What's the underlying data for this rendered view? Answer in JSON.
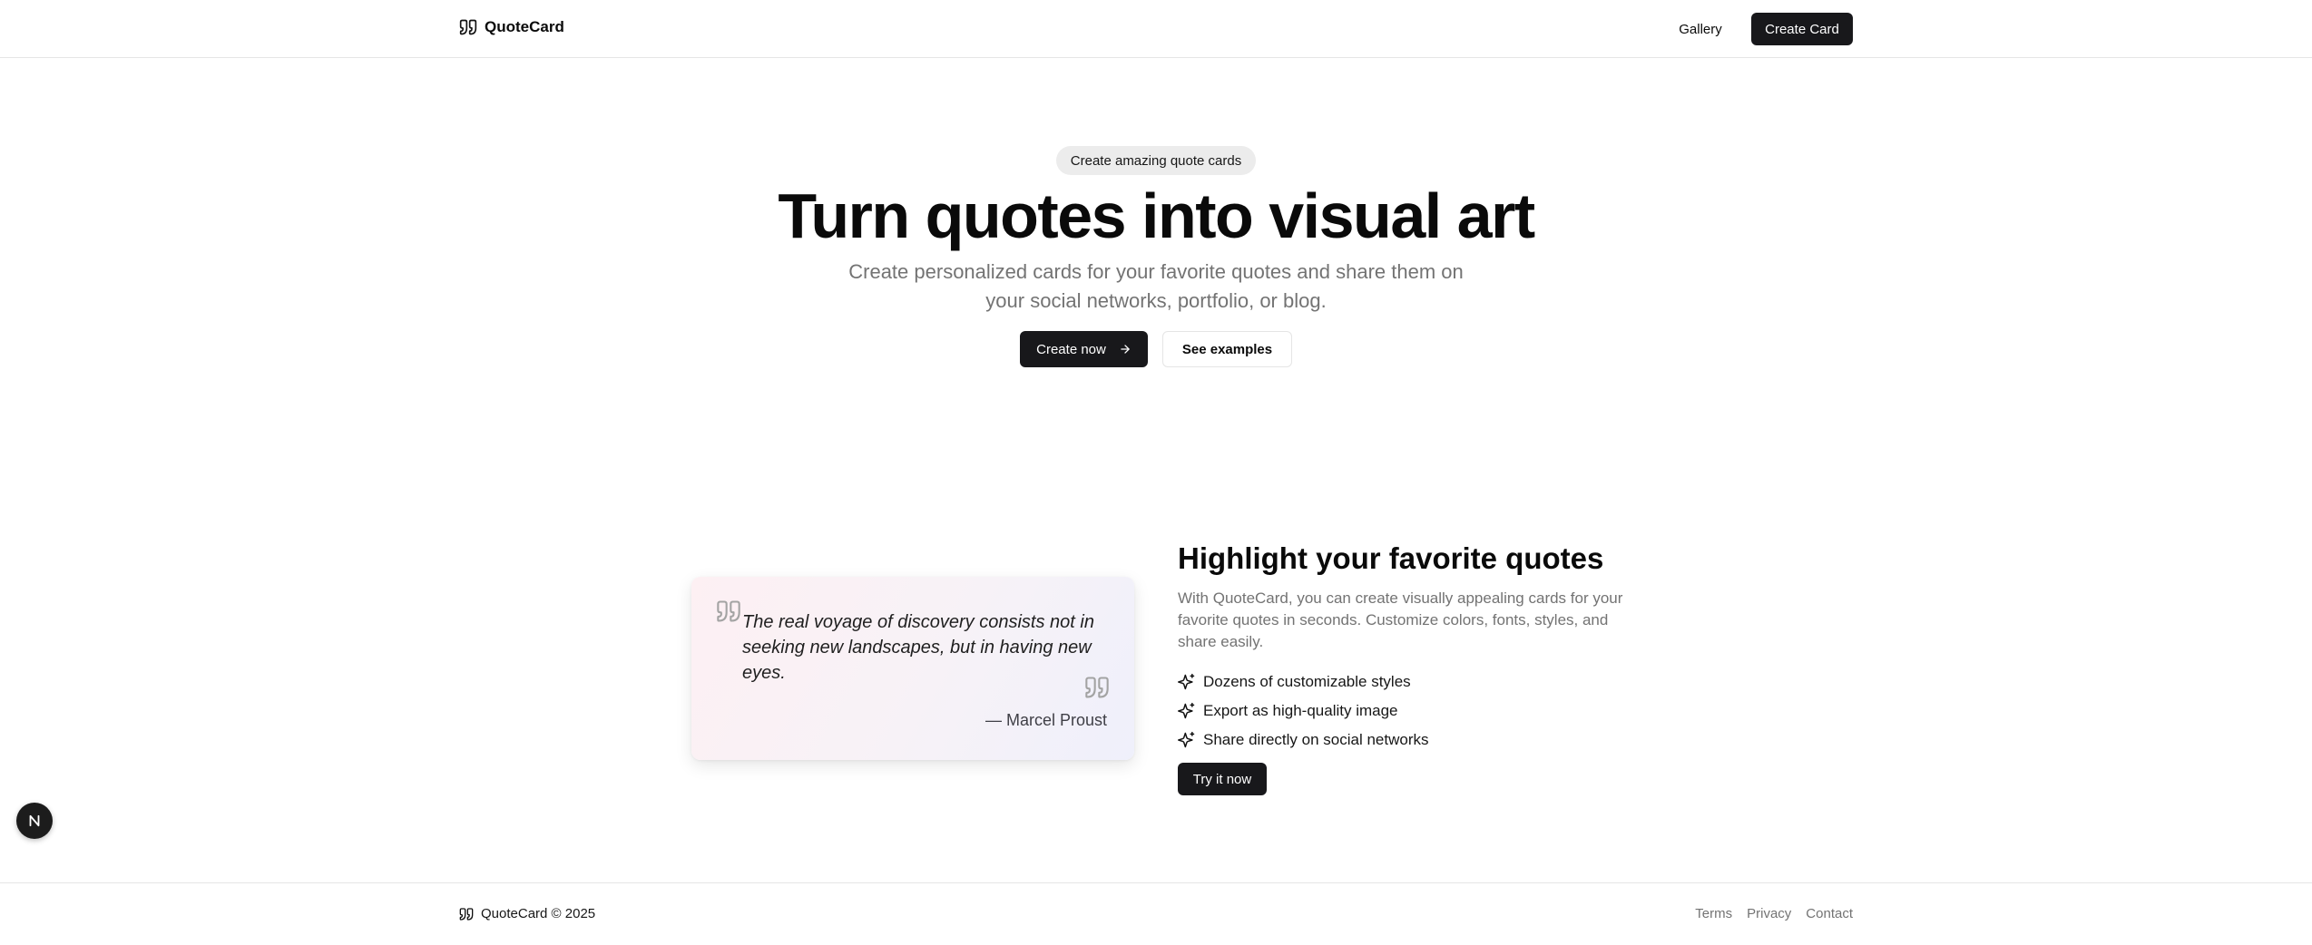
{
  "header": {
    "brand_name": "QuoteCard",
    "brand_icon": "quote-icon",
    "nav": {
      "gallery_label": "Gallery",
      "create_label": "Create Card"
    }
  },
  "hero": {
    "pill_label": "Create amazing quote cards",
    "title": "Turn quotes into visual art",
    "subtitle": "Create personalized cards for your favorite quotes and share them on your social networks, portfolio, or blog.",
    "primary_button": {
      "label": "Create now",
      "icon": "arrow-right-icon"
    },
    "secondary_button": {
      "label": "See examples"
    }
  },
  "quote_card": {
    "text": "The real voyage of discovery consists not in seeking new landscapes, but in having new eyes.",
    "author": "— Marcel Proust"
  },
  "feature": {
    "title": "Highlight your favorite quotes",
    "description": "With QuoteCard, you can create visually appealing cards for your favorite quotes in seconds. Customize colors, fonts, styles, and share easily.",
    "items": [
      {
        "label": "Dozens of customizable styles",
        "icon": "sparkles-icon"
      },
      {
        "label": "Export as high-quality image",
        "icon": "sparkles-icon"
      },
      {
        "label": "Share directly on social networks",
        "icon": "sparkles-icon"
      }
    ],
    "cta_label": "Try it now"
  },
  "floating_badge": {
    "letter": "N"
  },
  "footer": {
    "copyright": "QuoteCard © 2025",
    "links": [
      "Terms",
      "Privacy",
      "Contact"
    ]
  },
  "colors": {
    "primary": "#18181b",
    "muted_text": "#737373",
    "border": "#e5e5e5",
    "pill_bg": "#ececec"
  }
}
